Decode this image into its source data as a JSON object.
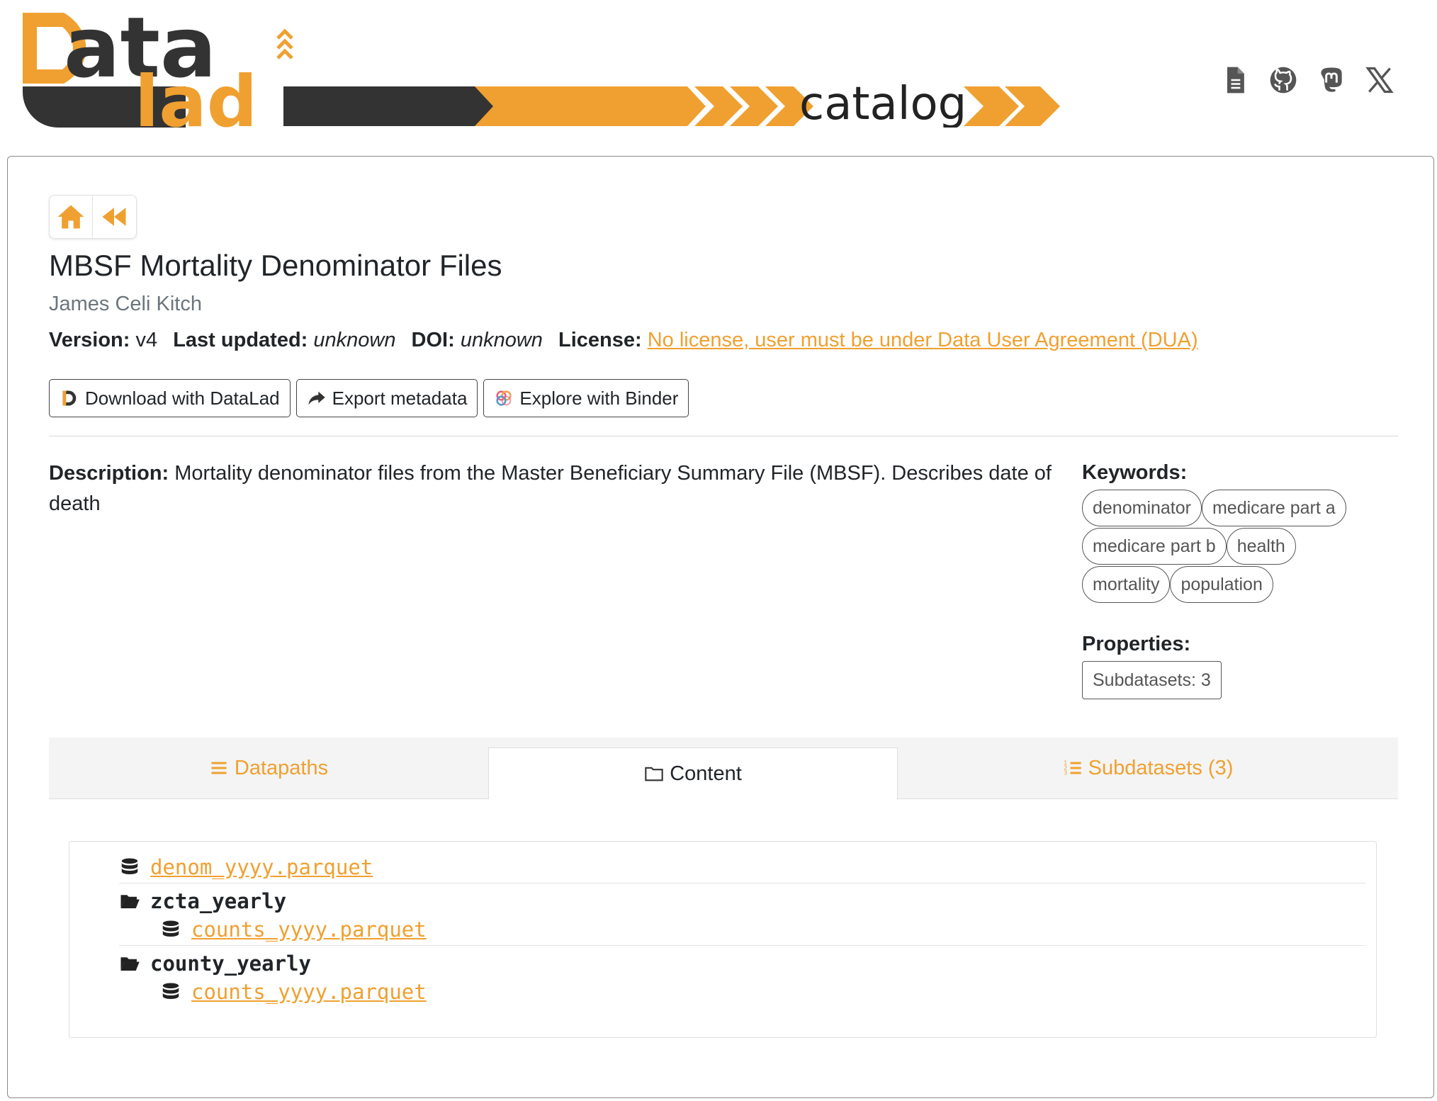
{
  "header": {
    "logo_text": "DataLad",
    "logo_subtitle": "catalog",
    "social": [
      "document-icon",
      "github-icon",
      "mastodon-icon",
      "x-icon"
    ]
  },
  "dataset": {
    "title": "MBSF Mortality Denominator Files",
    "author": "James Celi Kitch",
    "version_label": "Version:",
    "version": "v4",
    "updated_label": "Last updated:",
    "updated": "unknown",
    "doi_label": "DOI:",
    "doi": "unknown",
    "license_label": "License:",
    "license": "No license, user must be under Data User Agreement (DUA)"
  },
  "actions": {
    "download": "Download with DataLad",
    "export": "Export metadata",
    "binder": "Explore with Binder"
  },
  "description": {
    "label": "Description:",
    "text": "Mortality denominator files from the Master Beneficiary Summary File (MBSF). Describes date of death"
  },
  "keywords": {
    "label": "Keywords:",
    "items": [
      "denominator",
      "medicare part a",
      "medicare part b",
      "health",
      "mortality",
      "population"
    ]
  },
  "properties": {
    "label": "Properties:",
    "subdatasets": "Subdatasets: 3"
  },
  "tabs": {
    "datapaths": "Datapaths",
    "content": "Content",
    "subdatasets": "Subdatasets (3)"
  },
  "content": {
    "file1": "denom_yyyy.parquet",
    "folder1": "zcta_yearly",
    "file2": "counts_yyyy.parquet",
    "folder2": "county_yearly",
    "file3": "counts_yyyy.parquet"
  },
  "colors": {
    "accent": "#f0a030",
    "dark": "#333333"
  }
}
